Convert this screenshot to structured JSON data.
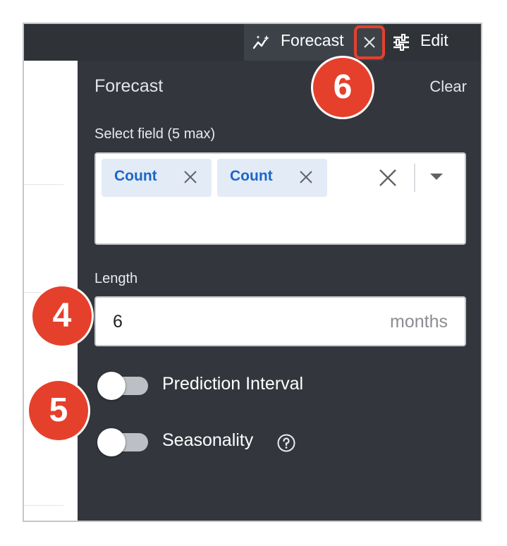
{
  "topbar": {
    "forecast_tab_label": "Forecast",
    "edit_tab_label": "Edit",
    "icons": [
      "sparkle-chart-icon",
      "close-icon",
      "sliders-icon"
    ]
  },
  "panel": {
    "title": "Forecast",
    "clear_label": "Clear",
    "select_field": {
      "label": "Select field (5 max)",
      "chips": [
        {
          "label": "Count"
        },
        {
          "label": "Count"
        }
      ]
    },
    "length": {
      "label": "Length",
      "value": "6",
      "unit": "months"
    },
    "toggles": [
      {
        "label": "Prediction Interval",
        "on": false
      },
      {
        "label": "Seasonality",
        "on": false
      }
    ]
  },
  "callouts": {
    "four": "4",
    "five": "5",
    "six": "6"
  },
  "colors": {
    "panel_bg": "#33373d",
    "topbar_bg": "#2f3338",
    "chip_bg": "#e3ebf7",
    "chip_text": "#1a66c9",
    "callout": "#e5402c"
  }
}
